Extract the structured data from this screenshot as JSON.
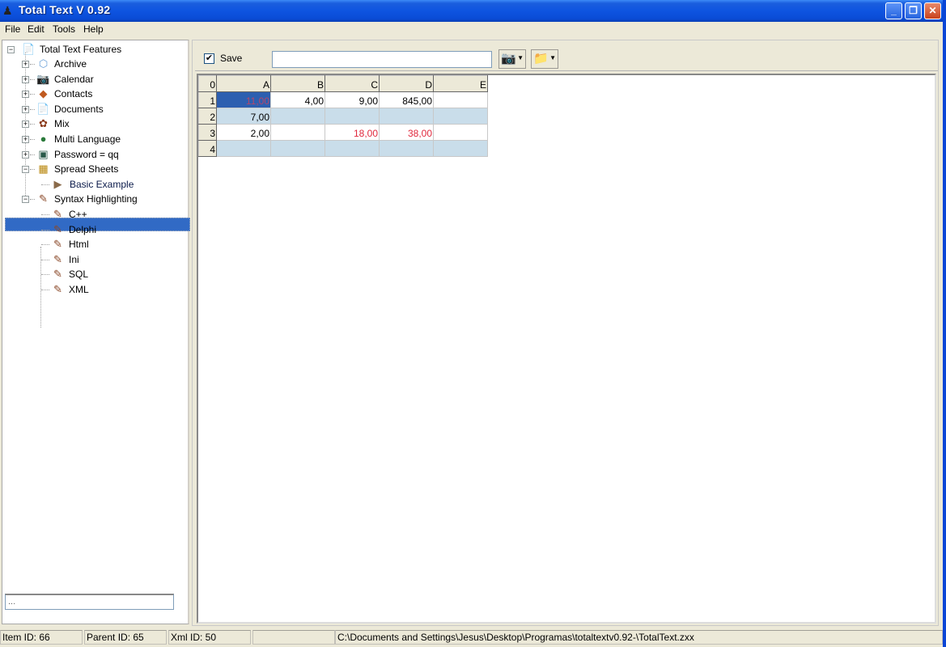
{
  "window": {
    "title": "Total Text V 0.92",
    "app_icon": "user-icon"
  },
  "window_controls": {
    "minimize": "_",
    "restore": "❐",
    "close": "✕"
  },
  "menu": [
    "File",
    "Edit",
    "Tools",
    "Help"
  ],
  "tree": {
    "root": {
      "label": "Total Text Features",
      "icon": "document-icon",
      "expanded": true
    },
    "items": [
      {
        "label": "Archive",
        "icon": "archive-icon",
        "expander": "+"
      },
      {
        "label": "Calendar",
        "icon": "calendar-icon",
        "expander": "+"
      },
      {
        "label": "Contacts",
        "icon": "contacts-icon",
        "expander": "+"
      },
      {
        "label": "Documents",
        "icon": "document-icon",
        "expander": "+"
      },
      {
        "label": "Mix",
        "icon": "mix-icon",
        "expander": "+"
      },
      {
        "label": "Multi Language",
        "icon": "globe-icon",
        "expander": "+"
      },
      {
        "label": "Password = qq",
        "icon": "password-icon",
        "expander": "+"
      },
      {
        "label": "Spread Sheets",
        "icon": "calculator-icon",
        "expander": "−"
      },
      {
        "label": "Basic Example",
        "icon": "arrow-icon",
        "selected": true,
        "child": true
      },
      {
        "label": "Syntax Highlighting",
        "icon": "quill-icon",
        "expander": "−"
      },
      {
        "label": "C++",
        "icon": "quill-icon",
        "child": true
      },
      {
        "label": "Delphi",
        "icon": "quill-icon",
        "child": true
      },
      {
        "label": "Html",
        "icon": "quill-icon",
        "child": true
      },
      {
        "label": "Ini",
        "icon": "quill-icon",
        "child": true
      },
      {
        "label": "SQL",
        "icon": "quill-icon",
        "child": true
      },
      {
        "label": "XML",
        "icon": "quill-icon",
        "child": true
      }
    ]
  },
  "search_box": {
    "value": "..."
  },
  "toolbar": {
    "save_checked": true,
    "save_label": "Save",
    "name_value": "",
    "btn1_icon": "camera-icon",
    "btn2_icon": "folder-icon"
  },
  "sheet": {
    "corner": "0",
    "columns": [
      "A",
      "B",
      "C",
      "D",
      "E"
    ],
    "rows": [
      {
        "label": "1",
        "cells": [
          "11,00",
          "4,00",
          "9,00",
          "845,00",
          ""
        ]
      },
      {
        "label": "2",
        "cells": [
          "7,00",
          "",
          "",
          "",
          ""
        ]
      },
      {
        "label": "3",
        "cells": [
          "2,00",
          "",
          "18,00",
          "38,00",
          ""
        ]
      },
      {
        "label": "4",
        "cells": [
          "",
          "",
          "",
          "",
          ""
        ]
      }
    ],
    "selected_cell": "A1",
    "red_cells": [
      "C3",
      "D3"
    ]
  },
  "status": {
    "item_id": "Item ID: 66",
    "parent_id": "Parent ID: 65",
    "xml_id": "Xml ID: 50",
    "empty": "",
    "path": "C:\\Documents and Settings\\Jesus\\Desktop\\Programas\\totaltextv0.92-\\TotalText.zxx"
  }
}
